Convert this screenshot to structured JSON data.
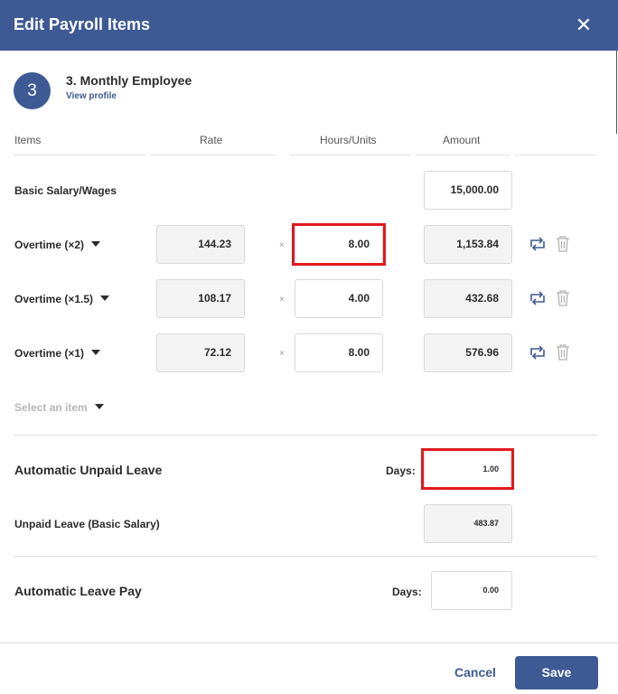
{
  "dialog": {
    "title": "Edit Payroll Items"
  },
  "employee": {
    "number": "3",
    "name": "3. Monthly Employee",
    "view_profile": "View profile"
  },
  "columns": {
    "items": "Items",
    "rate": "Rate",
    "hours": "Hours/Units",
    "amount": "Amount"
  },
  "basic": {
    "label": "Basic Salary/Wages",
    "amount": "15,000.00"
  },
  "overtime": [
    {
      "label": "Overtime (×2)",
      "rate": "144.23",
      "hours": "8.00",
      "amount": "1,153.84"
    },
    {
      "label": "Overtime (×1.5)",
      "rate": "108.17",
      "hours": "4.00",
      "amount": "432.68"
    },
    {
      "label": "Overtime (×1)",
      "rate": "72.12",
      "hours": "8.00",
      "amount": "576.96"
    }
  ],
  "multiply_symbol": "×",
  "select_item": {
    "placeholder": "Select an item"
  },
  "unpaid_leave": {
    "title": "Automatic Unpaid Leave",
    "days_label": "Days:",
    "days": "1.00",
    "deduction_label": "Unpaid Leave (Basic Salary)",
    "deduction_amount": "483.87"
  },
  "leave_pay": {
    "title": "Automatic Leave Pay",
    "days_label": "Days:",
    "days": "0.00"
  },
  "footer": {
    "cancel": "Cancel",
    "save": "Save"
  },
  "icons": {
    "close": "close-icon",
    "refresh": "refresh-icon",
    "delete": "trash-icon",
    "caret": "caret-down-icon"
  },
  "colors": {
    "primary": "#3e5a95",
    "highlight": "#e0191f"
  }
}
